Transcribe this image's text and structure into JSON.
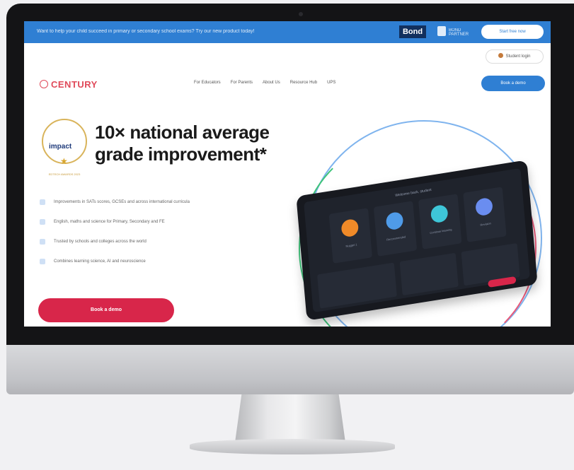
{
  "promo_bar": {
    "text": "Want to help your child succeed in primary or secondary school exams? Try our new product today!",
    "bond_logo": "Bond",
    "partner_text": "BOND PARTNER",
    "cta": "Start free now"
  },
  "header": {
    "login": "Student login",
    "logo": "CENTURY",
    "nav": [
      "For Educators",
      "For Parents",
      "About Us",
      "Resource Hub",
      "UPS"
    ],
    "cta": "Book a demo"
  },
  "hero": {
    "award_word": "impact",
    "award_caption": "EDTECH AWARDS 2023",
    "headline": "10× national average grade improvement*",
    "features": [
      "Improvements in SATs scores, GCSEs and across international curricula",
      "English, maths and science for Primary, Secondary and FE",
      "Trusted by schools and colleges across the world",
      "Combines learning science, AI and neuroscience"
    ],
    "cta": "Book a demo"
  },
  "device": {
    "title": "Welcome back, student",
    "cards": [
      "Nugget 1",
      "Recommended",
      "Continue learning",
      "Revision"
    ]
  },
  "colors": {
    "brand_blue": "#2f7fd3",
    "brand_red": "#d8264a",
    "logo_red": "#e04a5a"
  }
}
